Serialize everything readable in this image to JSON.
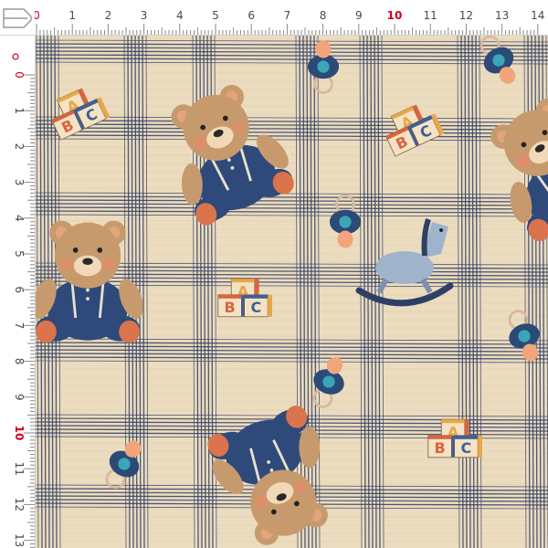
{
  "ruler": {
    "unit": "cm",
    "top_labels": [
      "0",
      "1",
      "2",
      "3",
      "4",
      "5",
      "6",
      "7",
      "8",
      "9",
      "10",
      "11",
      "12",
      "13",
      "14"
    ],
    "left_labels": [
      "0",
      "1",
      "2",
      "3",
      "4",
      "5",
      "6",
      "7",
      "8",
      "9",
      "10",
      "11",
      "12",
      "13"
    ],
    "highlight_label": "10",
    "highlight_color": "#d0021b",
    "origin_color": "#d0021b",
    "label_color": "#4a4a4a"
  },
  "fabric": {
    "background_color": "#ecdcbf",
    "plaid_color": "#2f3f66",
    "bear_color": "#c79a6d",
    "overalls_color": "#2f4a7a",
    "cheek_color": "#e88a6a",
    "block_labels": [
      "A",
      "B",
      "C"
    ],
    "block_colors": [
      "#e8a74a",
      "#d9643f",
      "#3f5f96"
    ],
    "pacifier_color": "#2b4a78",
    "pacifier_accent": "#3aa7b8",
    "pacifier_shield": "#f2a57a"
  }
}
